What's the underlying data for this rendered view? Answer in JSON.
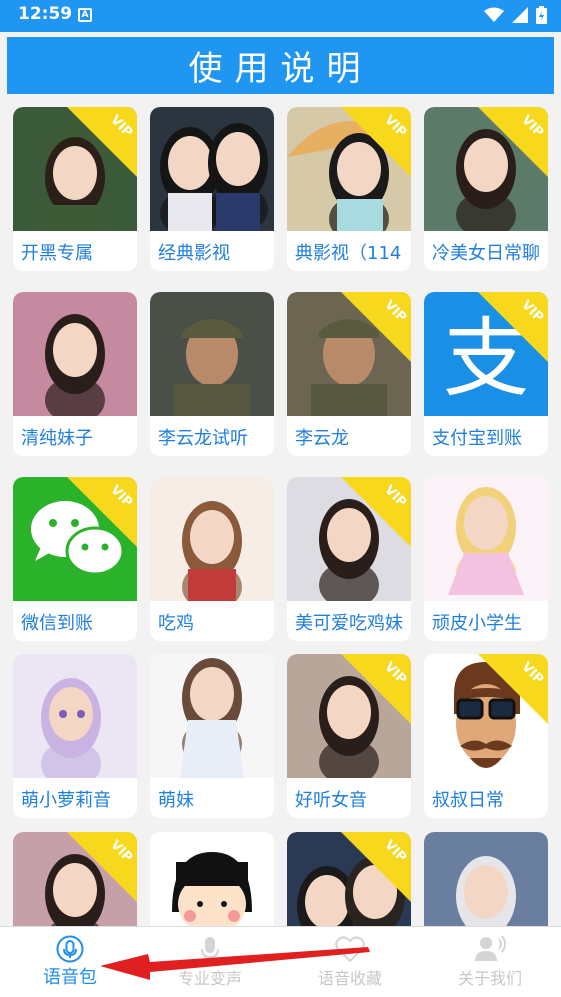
{
  "status": {
    "time": "12:59",
    "a_icon": "A"
  },
  "header": {
    "title": "使用说明"
  },
  "cards": [
    {
      "label": "开黑专属",
      "vip": true,
      "bg": "#3a5a3a",
      "icon": "portrait-soldier-girl"
    },
    {
      "label": "经典影视",
      "vip": false,
      "bg": "#2b3540",
      "icon": "portrait-costume"
    },
    {
      "label": "典影视（114",
      "vip": true,
      "bg": "#d6c9a8",
      "icon": "portrait-umbrella"
    },
    {
      "label": "冷美女日常聊",
      "vip": true,
      "bg": "#5b7a6a",
      "icon": "portrait-girl-dino"
    },
    {
      "label": "清纯妹子",
      "vip": false,
      "bg": "#c58aa0",
      "icon": "portrait-girl-pink"
    },
    {
      "label": "李云龙试听",
      "vip": false,
      "bg": "#4a5048",
      "icon": "portrait-soldier"
    },
    {
      "label": "李云龙",
      "vip": true,
      "bg": "#6b6552",
      "icon": "portrait-soldier-2"
    },
    {
      "label": "支付宝到账",
      "vip": true,
      "bg": "#1a8fe6",
      "icon": "alipay-logo"
    },
    {
      "label": "微信到账",
      "vip": true,
      "bg": "#2ab32a",
      "icon": "wechat-logo"
    },
    {
      "label": "吃鸡",
      "vip": false,
      "bg": "#f6eee6",
      "icon": "anime-girl-brown"
    },
    {
      "label": "美可爱吃鸡妹",
      "vip": true,
      "bg": "#dcdce2",
      "icon": "portrait-girl-cat"
    },
    {
      "label": "顽皮小学生",
      "vip": false,
      "bg": "#fbf3f8",
      "icon": "anime-girl-dress"
    },
    {
      "label": "萌小萝莉音",
      "vip": false,
      "bg": "#ece6f4",
      "icon": "anime-girl-lilac"
    },
    {
      "label": "萌妹",
      "vip": false,
      "bg": "#f6f6f6",
      "icon": "anime-girl-kimono"
    },
    {
      "label": "好听女音",
      "vip": true,
      "bg": "#b9a69a",
      "icon": "portrait-girl-lying"
    },
    {
      "label": "叔叔日常",
      "vip": true,
      "bg": "#ffffff",
      "icon": "mustache-man"
    },
    {
      "label": "",
      "vip": true,
      "bg": "#c6a0a8",
      "icon": "portrait-girl-buns"
    },
    {
      "label": "",
      "vip": false,
      "bg": "#ffffff",
      "icon": "cartoon-maruko"
    },
    {
      "label": "",
      "vip": true,
      "bg": "#2a3a55",
      "icon": "portrait-boys"
    },
    {
      "label": "",
      "vip": false,
      "bg": "#6a7fa0",
      "icon": "portrait-boy-white-hair"
    }
  ],
  "vip_text": "VIP",
  "tabs": [
    {
      "label": "语音包",
      "icon": "microphone-icon",
      "active": true
    },
    {
      "label": "专业变声",
      "icon": "voice-change-icon",
      "active": false
    },
    {
      "label": "语音收藏",
      "icon": "heart-icon",
      "active": false
    },
    {
      "label": "关于我们",
      "icon": "user-sound-icon",
      "active": false
    }
  ],
  "colors": {
    "accent": "#1f96f2",
    "vip": "#f8d81c",
    "label": "#1f7fe0",
    "annotation_arrow": "#e02020"
  }
}
